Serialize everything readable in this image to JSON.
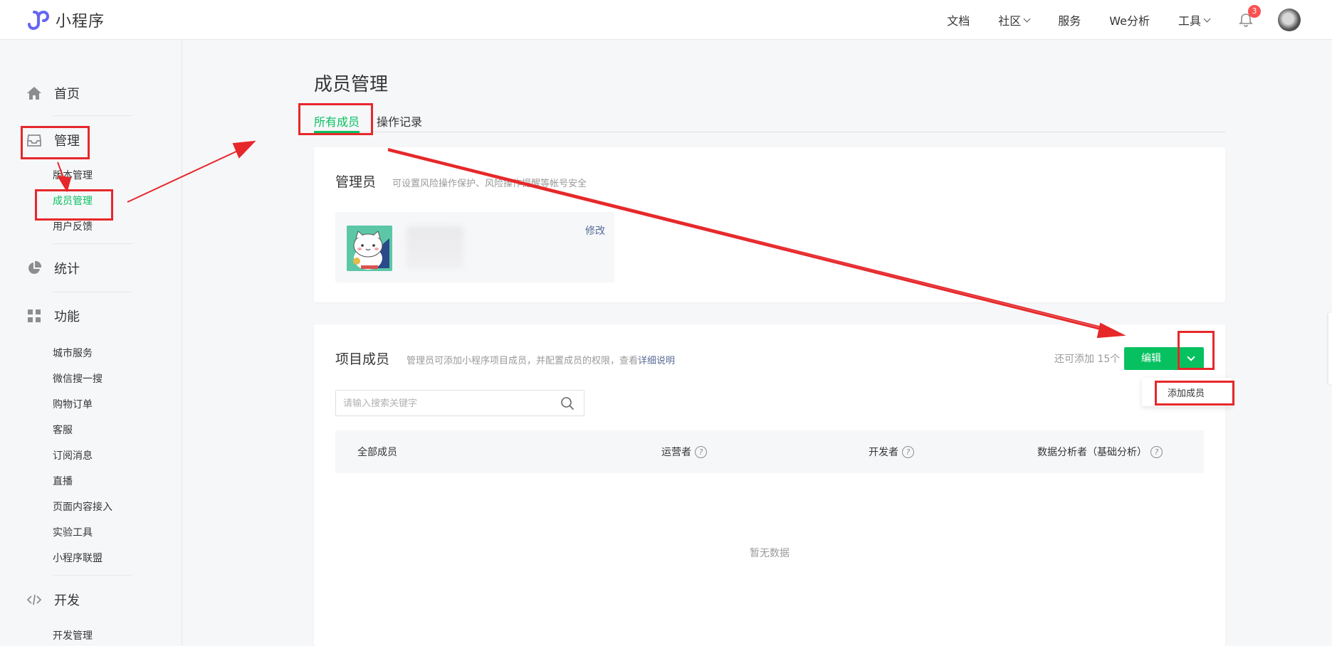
{
  "app": {
    "title": "小程序"
  },
  "topnav": {
    "items": [
      {
        "label": "文档",
        "dropdown": false
      },
      {
        "label": "社区",
        "dropdown": true
      },
      {
        "label": "服务",
        "dropdown": false
      },
      {
        "label": "We分析",
        "dropdown": false
      },
      {
        "label": "工具",
        "dropdown": true
      }
    ],
    "notification_count": "3"
  },
  "sidebar": {
    "home": "首页",
    "manage": "管理",
    "manage_items": [
      "版本管理",
      "成员管理",
      "用户反馈"
    ],
    "stats": "统计",
    "features": "功能",
    "feature_items": [
      "城市服务",
      "微信搜一搜",
      "购物订单",
      "客服",
      "订阅消息",
      "直播",
      "页面内容接入",
      "实验工具",
      "小程序联盟"
    ],
    "dev": "开发",
    "dev_items": [
      "开发管理"
    ]
  },
  "main": {
    "title": "成员管理",
    "tabs": [
      "所有成员",
      "操作记录"
    ],
    "admin": {
      "title": "管理员",
      "desc": "可设置风险操作保护、风险操作提醒等帐号安全",
      "edit": "修改"
    },
    "project": {
      "title": "项目成员",
      "desc": "管理员可添加小程序项目成员，并配置成员的权限，查看",
      "desc_link": "详细说明",
      "quota": "还可添加 15个",
      "edit_button": "编辑",
      "dropdown_item": "添加成员",
      "search_placeholder": "请输入搜索关键字",
      "columns": [
        "全部成员",
        "运营者",
        "开发者",
        "数据分析者（基础分析）"
      ],
      "empty": "暂无数据"
    }
  },
  "colors": {
    "accent": "#07c160",
    "link": "#576b95",
    "annotation": "#e6282b",
    "badge": "#fa5151"
  }
}
